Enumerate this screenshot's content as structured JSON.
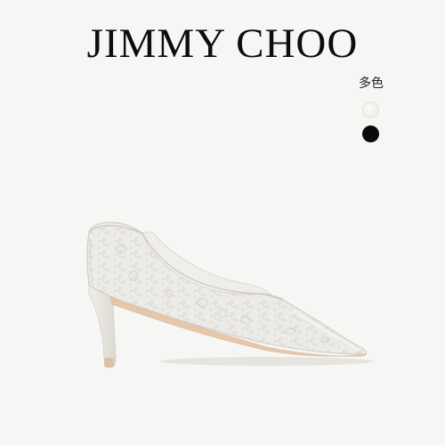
{
  "brand": {
    "name": "JIMMY CHOO"
  },
  "colors": {
    "label": "多色",
    "swatches": [
      {
        "icon": "white-swatch",
        "color": "#f2efe8"
      },
      {
        "icon": "black-swatch",
        "color": "#0a0a0a"
      }
    ]
  },
  "product": {
    "icon": "lace-pump-shoe",
    "color": "#ecebe6",
    "sole_color": "#e8c8ac"
  }
}
